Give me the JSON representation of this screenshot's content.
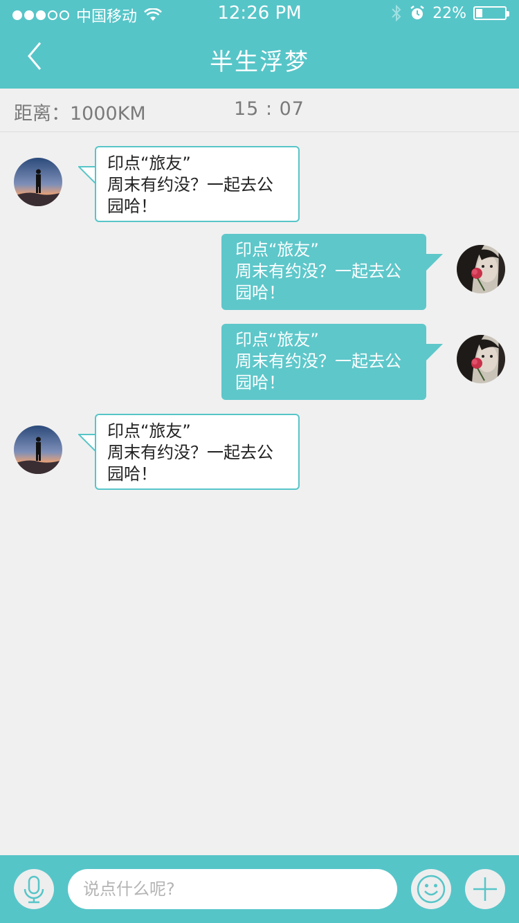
{
  "status_bar": {
    "carrier": "中国移动",
    "time": "12:26 PM",
    "battery": "22%",
    "battery_level": 0.22,
    "signal_bars_filled": 3,
    "signal_bars_total": 5
  },
  "nav": {
    "title": "半生浮梦"
  },
  "info": {
    "distance": "距离：1000KM",
    "time": "15 : 07"
  },
  "messages": [
    {
      "side": "incoming",
      "lines": [
        "印点“旅友”",
        "周末有约没？一起去公",
        "园哈！"
      ]
    },
    {
      "side": "outgoing",
      "lines": [
        "印点“旅友”",
        "周末有约没？一起去公",
        "园哈！"
      ]
    },
    {
      "side": "outgoing",
      "lines": [
        "印点“旅友”",
        "周末有约没？一起去公",
        "园哈！"
      ]
    },
    {
      "side": "incoming",
      "lines": [
        "印点“旅友”",
        "周末有约没？一起去公",
        "园哈！"
      ]
    }
  ],
  "input": {
    "placeholder": "说点什么呢?"
  },
  "icons": {
    "back": "chevron-left-icon",
    "voice": "microphone-icon",
    "emoji": "smiley-icon",
    "more": "plus-icon"
  },
  "colors": {
    "accent": "#56c5c8",
    "outgoing_bubble": "#5ec7ca",
    "background": "#f0f0f0"
  }
}
